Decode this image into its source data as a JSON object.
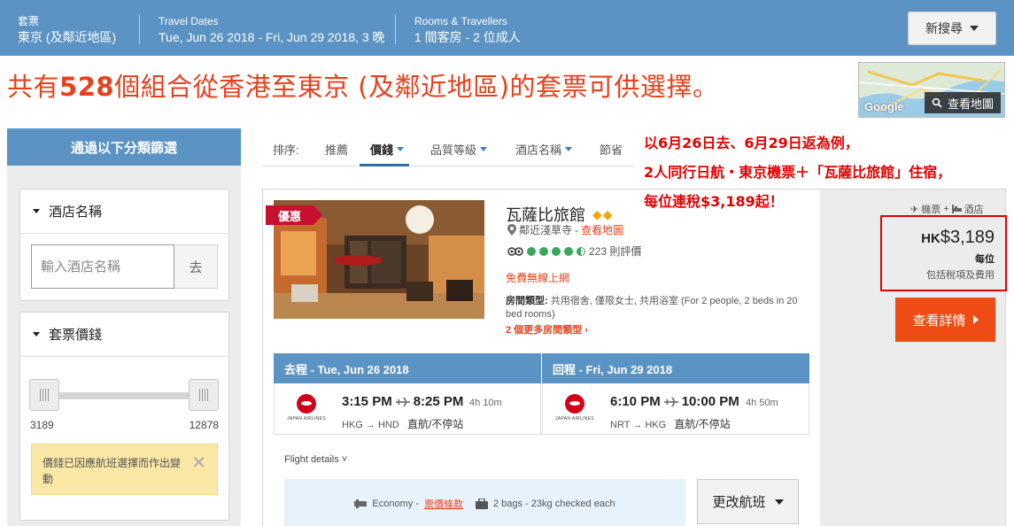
{
  "topbar": {
    "package_label": "套票",
    "package_value": "東京 (及鄰近地區)",
    "dates_label": "Travel Dates",
    "dates_value": "Tue, Jun 26 2018 - Fri, Jun 29 2018, 3 晚",
    "rooms_label": "Rooms & Travellers",
    "rooms_value": "1 間客房 - 2 位成人",
    "new_search": "新搜尋"
  },
  "headline": {
    "prefix": "共有",
    "count": "528",
    "suffix": "個組合從香港至東京 (及鄰近地區)的套票可供選擇。"
  },
  "map": {
    "google": "Google",
    "view_map": "查看地圖"
  },
  "sidebar": {
    "header": "通過以下分類篩選",
    "hotel_name_title": "酒店名稱",
    "hotel_name_placeholder": "輸入酒店名稱",
    "go": "去",
    "price_title": "套票價錢",
    "price_min": "3189",
    "price_max": "12878",
    "notice": "價錢已因應航班選擇而作出變動"
  },
  "sort": {
    "label": "排序:",
    "items": [
      "推薦",
      "價錢",
      "品質等級",
      "酒店名稱",
      "節省"
    ]
  },
  "annotation": {
    "line1": "以6月26日去、6月29日返為例，",
    "line2": "2人同行日航・東京機票＋「瓦薩比旅館」住宿，",
    "line3": "每位連稅$3,189起！"
  },
  "hotel": {
    "deal": "優惠",
    "name": "瓦薩比旅館",
    "stars": "◆◆",
    "location": "鄰近淺草寺",
    "location_sep": " - ",
    "map_link": "查看地圖",
    "reviews": "223 則評價",
    "wifi": "免費無線上網",
    "roomtype_label": "房間類型:",
    "roomtype_value": " 共用宿舍, 僅限女士, 共用浴室 (For 2 people, 2 beds in 20 bed rooms)",
    "more_rooms": "2 個更多房間類型 ›"
  },
  "outbound": {
    "header": "去程 - Tue, Jun 26 2018",
    "depart": "3:15 PM",
    "arrive": "8:25 PM",
    "duration": "4h 10m",
    "route": "HKG → HND",
    "stops": "直航/不停站",
    "airline": "JAPAN AIRLINES"
  },
  "inbound": {
    "header": "回程 - Fri, Jun 29 2018",
    "depart": "6:10 PM",
    "arrive": "10:00 PM",
    "duration": "4h 50m",
    "route": "NRT → HKG",
    "stops": "直航/不停站",
    "airline": "JAPAN AIRLINES"
  },
  "flight_details": "Flight details ˅",
  "cabin": {
    "class": "Economy - ",
    "fare_link": "票價條款",
    "bags": "2 bags - 23kg checked each"
  },
  "change_flight": "更改航班",
  "pricing": {
    "pkg_flight": "機票",
    "pkg_plus": " + ",
    "pkg_hotel": "酒店",
    "currency": "HK",
    "amount": "$3,189",
    "per": "每位",
    "tax": "包括稅項及費用",
    "view_details": "查看詳情"
  },
  "colors": {
    "brand_blue": "#5b93c4",
    "accent_orange": "#ef4b14",
    "annotation_red": "#e30000"
  }
}
